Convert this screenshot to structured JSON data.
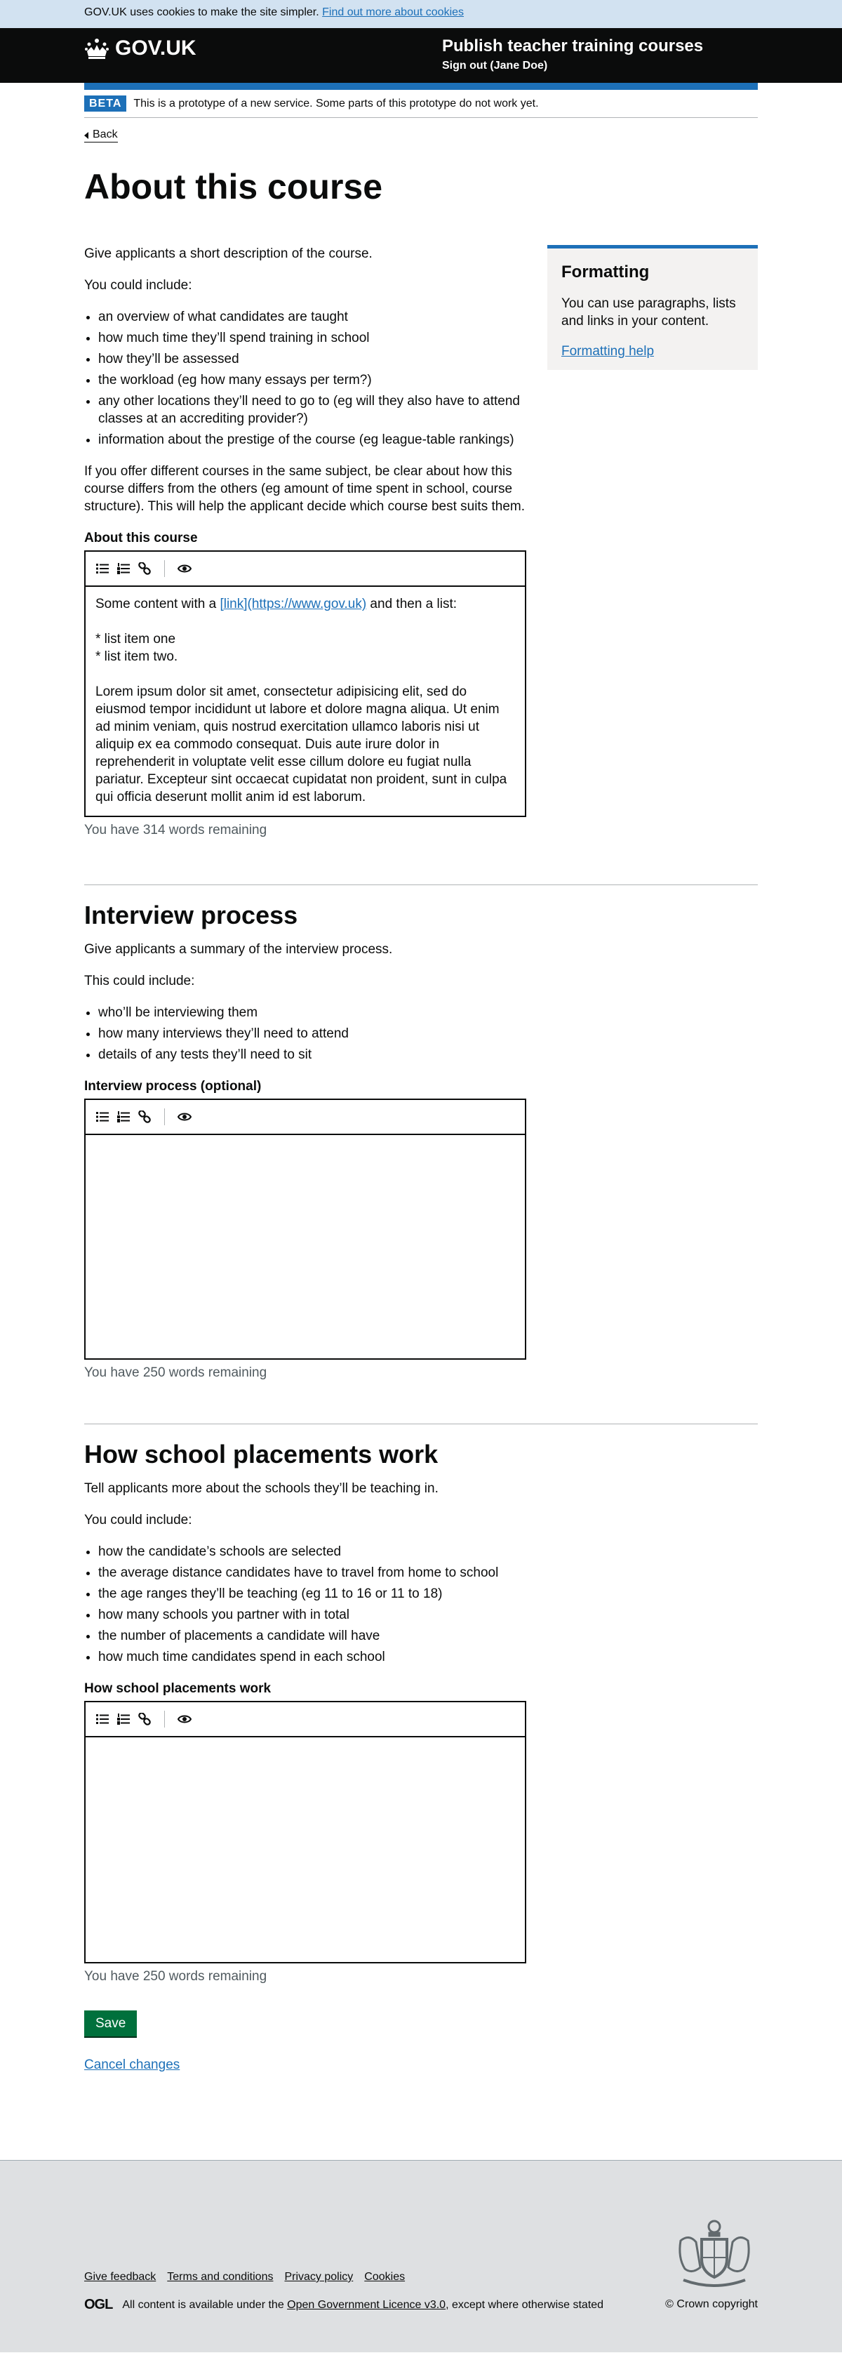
{
  "cookie_banner": {
    "text": "GOV.UK uses cookies to make the site simpler.",
    "link": "Find out more about cookies"
  },
  "header": {
    "logo": "GOV.UK",
    "service_name": "Publish teacher training courses",
    "sign_out": "Sign out (Jane Doe)"
  },
  "phase_banner": {
    "tag": "BETA",
    "text": "This is a prototype of a new service. Some parts of this prototype do not work yet."
  },
  "back_link": "Back",
  "page_title": "About this course",
  "about": {
    "intro": "Give applicants a short description of the course.",
    "could_include": "You could include:",
    "bullets": [
      "an overview of what candidates are taught",
      "how much time they’ll spend training in school",
      "how they’ll be assessed",
      "the workload (eg how many essays per term?)",
      "any other locations they’ll need to go to (eg will they also have to attend classes at an accrediting provider?)",
      "information about the prestige of the course (eg league-table rankings)"
    ],
    "advice": "If you offer different courses in the same subject, be clear about how this course differs from the others (eg amount of time spent in school, course structure). This will help the applicant decide which course best suits them.",
    "field_label": "About this course",
    "content_before_link": "Some content with a ",
    "content_link": "[link](https://www.gov.uk)",
    "content_after_link": " and then a list:\n\n* list item one\n* list item two.\n\nLorem ipsum dolor sit amet, consectetur adipisicing elit, sed do eiusmod tempor incididunt ut labore et dolore magna aliqua. Ut enim ad minim veniam, quis nostrud exercitation ullamco laboris nisi ut aliquip ex ea commodo consequat. Duis aute irure dolor in reprehenderit in voluptate velit esse cillum dolore eu fugiat nulla pariatur. Excepteur sint occaecat cupidatat non proident, sunt in culpa qui officia deserunt mollit anim id est laborum.",
    "words_remaining": "You have 314 words remaining"
  },
  "formatting": {
    "title": "Formatting",
    "text": "You can use paragraphs, lists and links in your content.",
    "link": "Formatting help"
  },
  "interview": {
    "title": "Interview process",
    "intro": "Give applicants a summary of the interview process.",
    "could_include": "This could include:",
    "bullets": [
      "who’ll be interviewing them",
      "how many interviews they’ll need to attend",
      "details of any tests they’ll need to sit"
    ],
    "field_label": "Interview process (optional)",
    "words_remaining": "You have 250 words remaining"
  },
  "placements": {
    "title": "How school placements work",
    "intro": "Tell applicants more about the schools they’ll be teaching in.",
    "could_include": "You could include:",
    "bullets": [
      "how the candidate’s schools are selected",
      "the average distance candidates have to travel from home to school",
      "the age ranges they’ll be teaching (eg 11 to 16 or 11 to 18)",
      "how many schools you partner with in total",
      "the number of placements a candidate will have",
      "how much time candidates spend in each school"
    ],
    "field_label": "How school placements work",
    "words_remaining": "You have 250 words remaining"
  },
  "actions": {
    "save": "Save",
    "cancel": "Cancel changes"
  },
  "footer": {
    "links": [
      "Give feedback",
      "Terms and conditions",
      "Privacy policy",
      "Cookies"
    ],
    "ogl": "OGL",
    "licence_before": "All content is available under the ",
    "licence_link": "Open Government Licence v3.0",
    "licence_after": ", except where otherwise stated",
    "copyright": "© Crown copyright"
  },
  "colors": {
    "link": "#1d70b8",
    "header_bg": "#0b0c0c",
    "cookie_bg": "#d2e2f1",
    "save_button": "#00703c",
    "footer_bg": "#dee0e2"
  }
}
